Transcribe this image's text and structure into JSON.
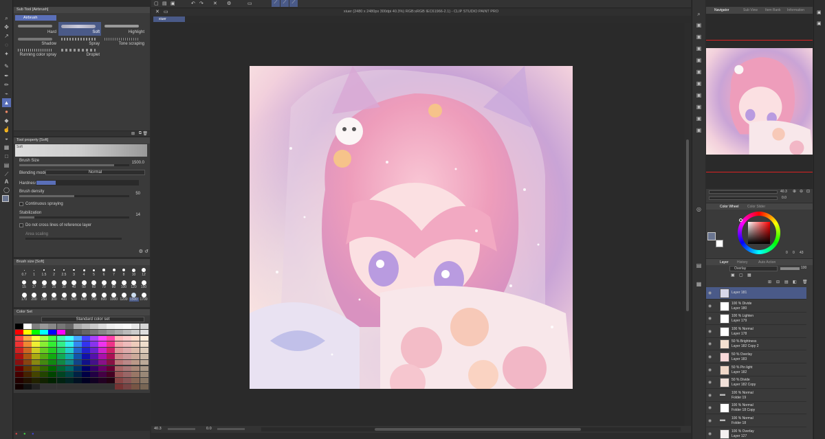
{
  "window": {
    "title": "xiuer (2480 x 2480px 300dpi 40.3%) RGB:sRGB IEC61966-2.1) - CLIP STUDIO PAINT PRO",
    "tab": "xiuer"
  },
  "subtool": {
    "header": "Sub Tool [Airbrush]",
    "group": "Airbrush",
    "brushes": [
      "Hard",
      "Soft",
      "Highlight",
      "Shadow",
      "Spray",
      "Tone scraping",
      "Running color spray",
      "Droplet"
    ]
  },
  "toolprop": {
    "header": "Tool property [Soft]",
    "preset": "Soft",
    "brush_size_label": "Brush Size",
    "brush_size_value": "1500.0",
    "blending_label": "Blending mode",
    "blending_value": "Normal",
    "hardness_label": "Hardness",
    "density_label": "Brush density",
    "density_value": "50",
    "continuous_label": "Continuous spraying",
    "stabilization_label": "Stabilization",
    "stabilization_value": "14",
    "nocross_label": "Do not cross lines of reference layer",
    "area_label": "Area scaling"
  },
  "brushsize": {
    "header": "Brush size [Soft]",
    "row1": [
      "0.7",
      "1",
      "1.5",
      "2",
      "2.5",
      "3",
      "4",
      "5",
      "6",
      "7",
      "8",
      "10",
      "12"
    ],
    "row2": [
      "15",
      "17",
      "20",
      "25",
      "30",
      "40",
      "50",
      "60",
      "70",
      "80",
      "100",
      "120",
      "150"
    ],
    "row3": [
      "170",
      "200",
      "250",
      "300",
      "400",
      "500",
      "600",
      "700",
      "800",
      "1000",
      "1200",
      "1500",
      "1700"
    ]
  },
  "colorset": {
    "header": "Color Set",
    "dropdown": "Standard color set"
  },
  "navigator": {
    "tabs": [
      "Navigator",
      "Sub View",
      "Item Bank",
      "Information"
    ],
    "zoom": "40.3",
    "angle": "0.0"
  },
  "colorwheel": {
    "tabs": [
      "Color Wheel",
      "Color Slider"
    ],
    "values": [
      "0",
      "0",
      "43"
    ]
  },
  "layerpanel": {
    "tabs": [
      "Layer",
      "History",
      "Auto Action"
    ],
    "blend": "Overlay",
    "opacity": "100",
    "layers": [
      {
        "mode": "",
        "name": "Layer 181",
        "color": "#d8d8e8"
      },
      {
        "mode": "100 % Divide",
        "name": "Layer 180",
        "color": "#ffffff"
      },
      {
        "mode": "100 % Lighten",
        "name": "Layer 179",
        "color": "#ffffff"
      },
      {
        "mode": "100 % Normal",
        "name": "Layer 178",
        "color": "#ffffff"
      },
      {
        "mode": "50 % Brightness",
        "name": "Layer 182 Copy 2",
        "color": "#f4e0d0"
      },
      {
        "mode": "50 % Overlay",
        "name": "Layer 183",
        "color": "#f8d8d8"
      },
      {
        "mode": "50 % Pin light",
        "name": "Layer 182",
        "color": "#f0d8c8"
      },
      {
        "mode": "50 % Divide",
        "name": "Layer 182 Copy",
        "color": "#f0e0d8"
      },
      {
        "mode": "100 % Normal",
        "name": "Folder 19",
        "color": ""
      },
      {
        "mode": "100 % Normal",
        "name": "Folder 18 Copy",
        "color": "#ffffff"
      },
      {
        "mode": "100 % Normal",
        "name": "Folder 18",
        "color": ""
      },
      {
        "mode": "100 % Overlay",
        "name": "Layer 127",
        "color": "#f4f0f0"
      }
    ]
  },
  "statusbar": {
    "zoom": "40.3",
    "angle": "0.0"
  },
  "colors": {
    "accent": "#5a6fb8",
    "selected_layer": "#4a5a88"
  }
}
